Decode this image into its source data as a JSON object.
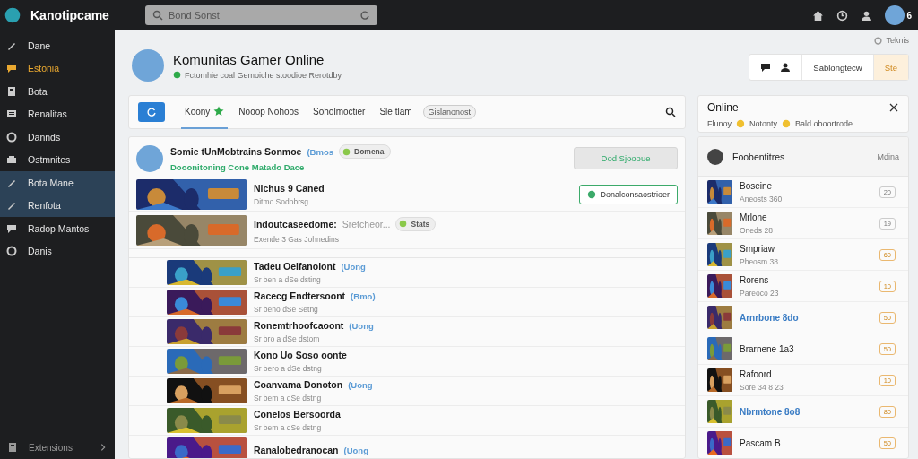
{
  "app": {
    "name": "Kanotipcame"
  },
  "search": {
    "placeholder": "Bond Sonst"
  },
  "topbar": {
    "badge": "6"
  },
  "sidebar": {
    "items": [
      {
        "label": "Dane",
        "selected": false,
        "accent": false
      },
      {
        "label": "Estonia",
        "selected": false,
        "accent": true
      },
      {
        "label": "Bota",
        "selected": false,
        "accent": false
      },
      {
        "label": "Renalitas",
        "selected": false,
        "accent": false
      },
      {
        "label": "Dannds",
        "selected": false,
        "accent": false
      },
      {
        "label": "Ostmnites",
        "selected": false,
        "accent": false
      },
      {
        "label": "Bota Mane",
        "selected": true,
        "accent": false
      },
      {
        "label": "Renfota",
        "selected": true,
        "accent": false
      },
      {
        "label": "Radop Mantos",
        "selected": false,
        "accent": false
      },
      {
        "label": "Danis",
        "selected": false,
        "accent": false
      }
    ],
    "footer": "Extensions"
  },
  "header": {
    "title": "Komunitas Gamer Online",
    "subtitle": "Fctomhie coal Gemoiche stoodioe Rerotdby",
    "corner": "Teknis"
  },
  "actions": [
    {
      "kind": "chat"
    },
    {
      "kind": "user"
    },
    {
      "kind": "text",
      "label": "Sablongtecw"
    },
    {
      "kind": "accent",
      "label": "Ste"
    }
  ],
  "tabs": [
    {
      "label": "Koony",
      "selected": true,
      "starred": true
    },
    {
      "label": "Nooop Nohoos",
      "selected": false,
      "starred": false
    },
    {
      "label": "Soholmoctier",
      "selected": false,
      "starred": false
    },
    {
      "label": "Sle tlam",
      "selected": false,
      "starred": false
    }
  ],
  "tab_pill": "Gislanonost",
  "online": {
    "title": "Online",
    "items": [
      "Flunoy",
      "Notonty",
      "Bald oboortrode"
    ]
  },
  "group": {
    "title": "Somie tUnMobtrains Sonmoe",
    "link": "(Bmos",
    "badge": "Domena",
    "subtitle": "Dooonitoning Cone Matado Dace",
    "button": "Dod Sjoooue"
  },
  "featured": [
    {
      "title": "Nichus 9 Caned",
      "sub": "Ditmo Sodobrsg",
      "button": "Donalconsaostrioer"
    },
    {
      "title": "Indoutcaseedome:",
      "note": "Sretcheor...",
      "badge": "Stats",
      "sub": "Exende 3 Gas Johnedins"
    }
  ],
  "games": [
    {
      "title": "Tadeu Oelfanoiont",
      "link": "(Uong",
      "sub": "Sr ben a dSe dsting"
    },
    {
      "title": "Racecg Endtersoont",
      "link": "(Bmo)",
      "sub": "Sr beno dSe Setng"
    },
    {
      "title": "Ronemtrhoofcaoont",
      "link": "(Uong",
      "sub": "Sr bro a dSe dstom"
    },
    {
      "title": "Kono Uo Soso oonte",
      "sub": "Sr bero a dSe dstng"
    },
    {
      "title": "Coanvama Donoton",
      "link": "(Uong",
      "sub": "Sr bem a dSe dstng"
    },
    {
      "title": "Conelos Bersoorda",
      "sub": "Sr bem a dSe dstng"
    },
    {
      "title": "Ranalobedranocan",
      "link": "(Uong"
    }
  ],
  "friends": {
    "title": "Foobentitres",
    "action": "Mdina",
    "items": [
      {
        "name": "Boseine",
        "sub": "Aneosts 360",
        "badge": "20",
        "highlighted": false,
        "linked": false
      },
      {
        "name": "Mrlone",
        "sub": "Oneds 28",
        "badge": "19",
        "highlighted": false,
        "linked": false
      },
      {
        "name": "Smpriaw",
        "sub": "Pheosm 38",
        "badge": "60",
        "highlighted": true,
        "linked": false
      },
      {
        "name": "Rorens",
        "sub": "Pareoco 23",
        "badge": "10",
        "highlighted": true,
        "linked": false
      },
      {
        "name": "Arnrbone 8do",
        "badge": "50",
        "highlighted": true,
        "linked": true
      },
      {
        "name": "Brarnene 1a3",
        "badge": "50",
        "highlighted": true,
        "linked": false
      },
      {
        "name": "Rafoord",
        "sub": "Sore 34 8 23",
        "badge": "10",
        "highlighted": true,
        "linked": false
      },
      {
        "name": "Nbrmtone 8o8",
        "badge": "80",
        "highlighted": true,
        "linked": true
      },
      {
        "name": "Pascam B",
        "badge": "50",
        "highlighted": true,
        "linked": false
      }
    ]
  }
}
